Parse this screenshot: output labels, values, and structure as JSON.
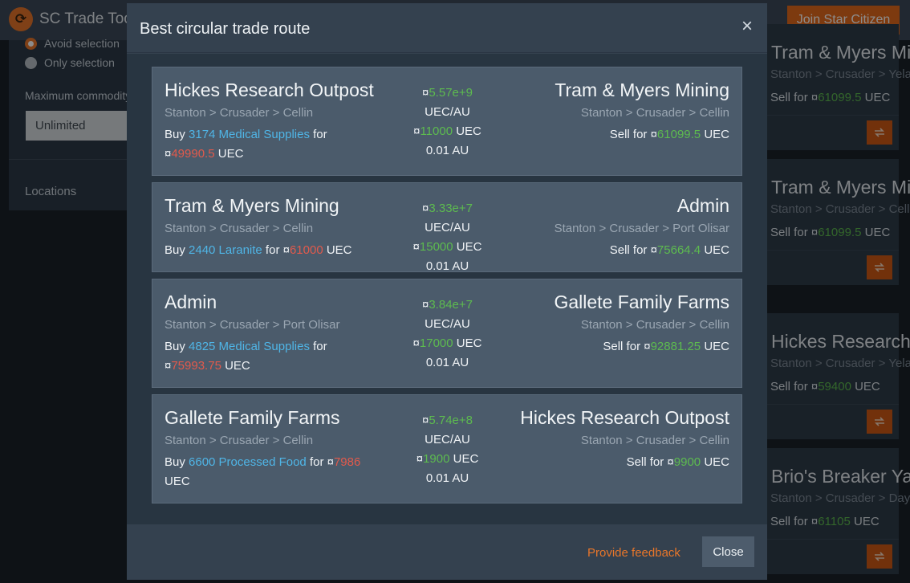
{
  "app": {
    "title": "SC Trade Tools",
    "join_label": "Join Star Citizen"
  },
  "sidebar": {
    "avoid_label": "Avoid selection",
    "only_label": "Only selection",
    "max_label": "Maximum commodity",
    "max_value": "Unlimited",
    "locations_label": "Locations"
  },
  "bg_cards": [
    {
      "title": "Tram & Myers Mining",
      "path": "Stanton > Crusader > Yela",
      "sell_prefix": "Sell for ¤",
      "sell_value": "61099.5",
      "sell_suffix": " UEC"
    },
    {
      "title": "Tram & Myers Mining",
      "path": "Stanton > Crusader > Cellin",
      "sell_prefix": "Sell for ¤",
      "sell_value": "61099.5",
      "sell_suffix": " UEC"
    },
    {
      "title": "Hickes Research Outpost",
      "path": "Stanton > Crusader > Yela",
      "sell_prefix": "Sell for ¤",
      "sell_value": "59400",
      "sell_suffix": " UEC"
    },
    {
      "title": "Brio's Breaker Yard",
      "path": "Stanton > Crusader > Daymar",
      "sell_prefix": "Sell for ¤",
      "sell_value": "61105",
      "sell_suffix": " UEC"
    }
  ],
  "modal": {
    "title": "Best circular trade route",
    "close_x": "×",
    "feedback_label": "Provide feedback",
    "close_label": "Close"
  },
  "routes": [
    {
      "from_name": "Hickes Research Outpost",
      "from_path": "Stanton > Crusader > Cellin",
      "buy_prefix": "Buy ",
      "commodity": "3174 Medical Supplies",
      "buy_mid": " for ",
      "buy_currency": "¤",
      "buy_price": "49990.5",
      "buy_suffix": " UEC",
      "rate": "5.57e+9",
      "rate_unit": "UEC/AU",
      "profit": "11000",
      "profit_unit": " UEC",
      "distance": "0.01 AU",
      "to_name": "Tram & Myers Mining",
      "to_path": "Stanton > Crusader > Cellin",
      "sell_prefix": "Sell for ¤",
      "sell_value": "61099.5",
      "sell_suffix": " UEC"
    },
    {
      "from_name": "Tram & Myers Mining",
      "from_path": "Stanton > Crusader > Cellin",
      "buy_prefix": "Buy ",
      "commodity": "2440 Laranite",
      "buy_mid": " for ",
      "buy_currency": "¤",
      "buy_price": "61000",
      "buy_suffix": " UEC",
      "rate": "3.33e+7",
      "rate_unit": "UEC/AU",
      "profit": "15000",
      "profit_unit": " UEC",
      "distance": "0.01 AU",
      "to_name": "Admin",
      "to_path": "Stanton > Crusader > Port Olisar",
      "sell_prefix": "Sell for ¤",
      "sell_value": "75664.4",
      "sell_suffix": " UEC"
    },
    {
      "from_name": "Admin",
      "from_path": "Stanton > Crusader > Port Olisar",
      "buy_prefix": "Buy ",
      "commodity": "4825 Medical Supplies",
      "buy_mid": " for ",
      "buy_currency": "¤",
      "buy_price": "75993.75",
      "buy_suffix": " UEC",
      "rate": "3.84e+7",
      "rate_unit": "UEC/AU",
      "profit": "17000",
      "profit_unit": " UEC",
      "distance": "0.01 AU",
      "to_name": "Gallete Family Farms",
      "to_path": "Stanton > Crusader > Cellin",
      "sell_prefix": "Sell for ¤",
      "sell_value": "92881.25",
      "sell_suffix": " UEC"
    },
    {
      "from_name": "Gallete Family Farms",
      "from_path": "Stanton > Crusader > Cellin",
      "buy_prefix": "Buy ",
      "commodity": "6600 Processed Food",
      "buy_mid": " for ",
      "buy_currency": "¤",
      "buy_price": "7986",
      "buy_suffix": " UEC",
      "rate": "5.74e+8",
      "rate_unit": "UEC/AU",
      "profit": "1900",
      "profit_unit": " UEC",
      "distance": "0.01 AU",
      "to_name": "Hickes Research Outpost",
      "to_path": "Stanton > Crusader > Cellin",
      "sell_prefix": "Sell for ¤",
      "sell_value": "9900",
      "sell_suffix": " UEC"
    }
  ],
  "colors": {
    "accent": "#e8762a",
    "commodity": "#4fb5e6",
    "profit": "#5dbb4f",
    "cost": "#e25a4c"
  }
}
